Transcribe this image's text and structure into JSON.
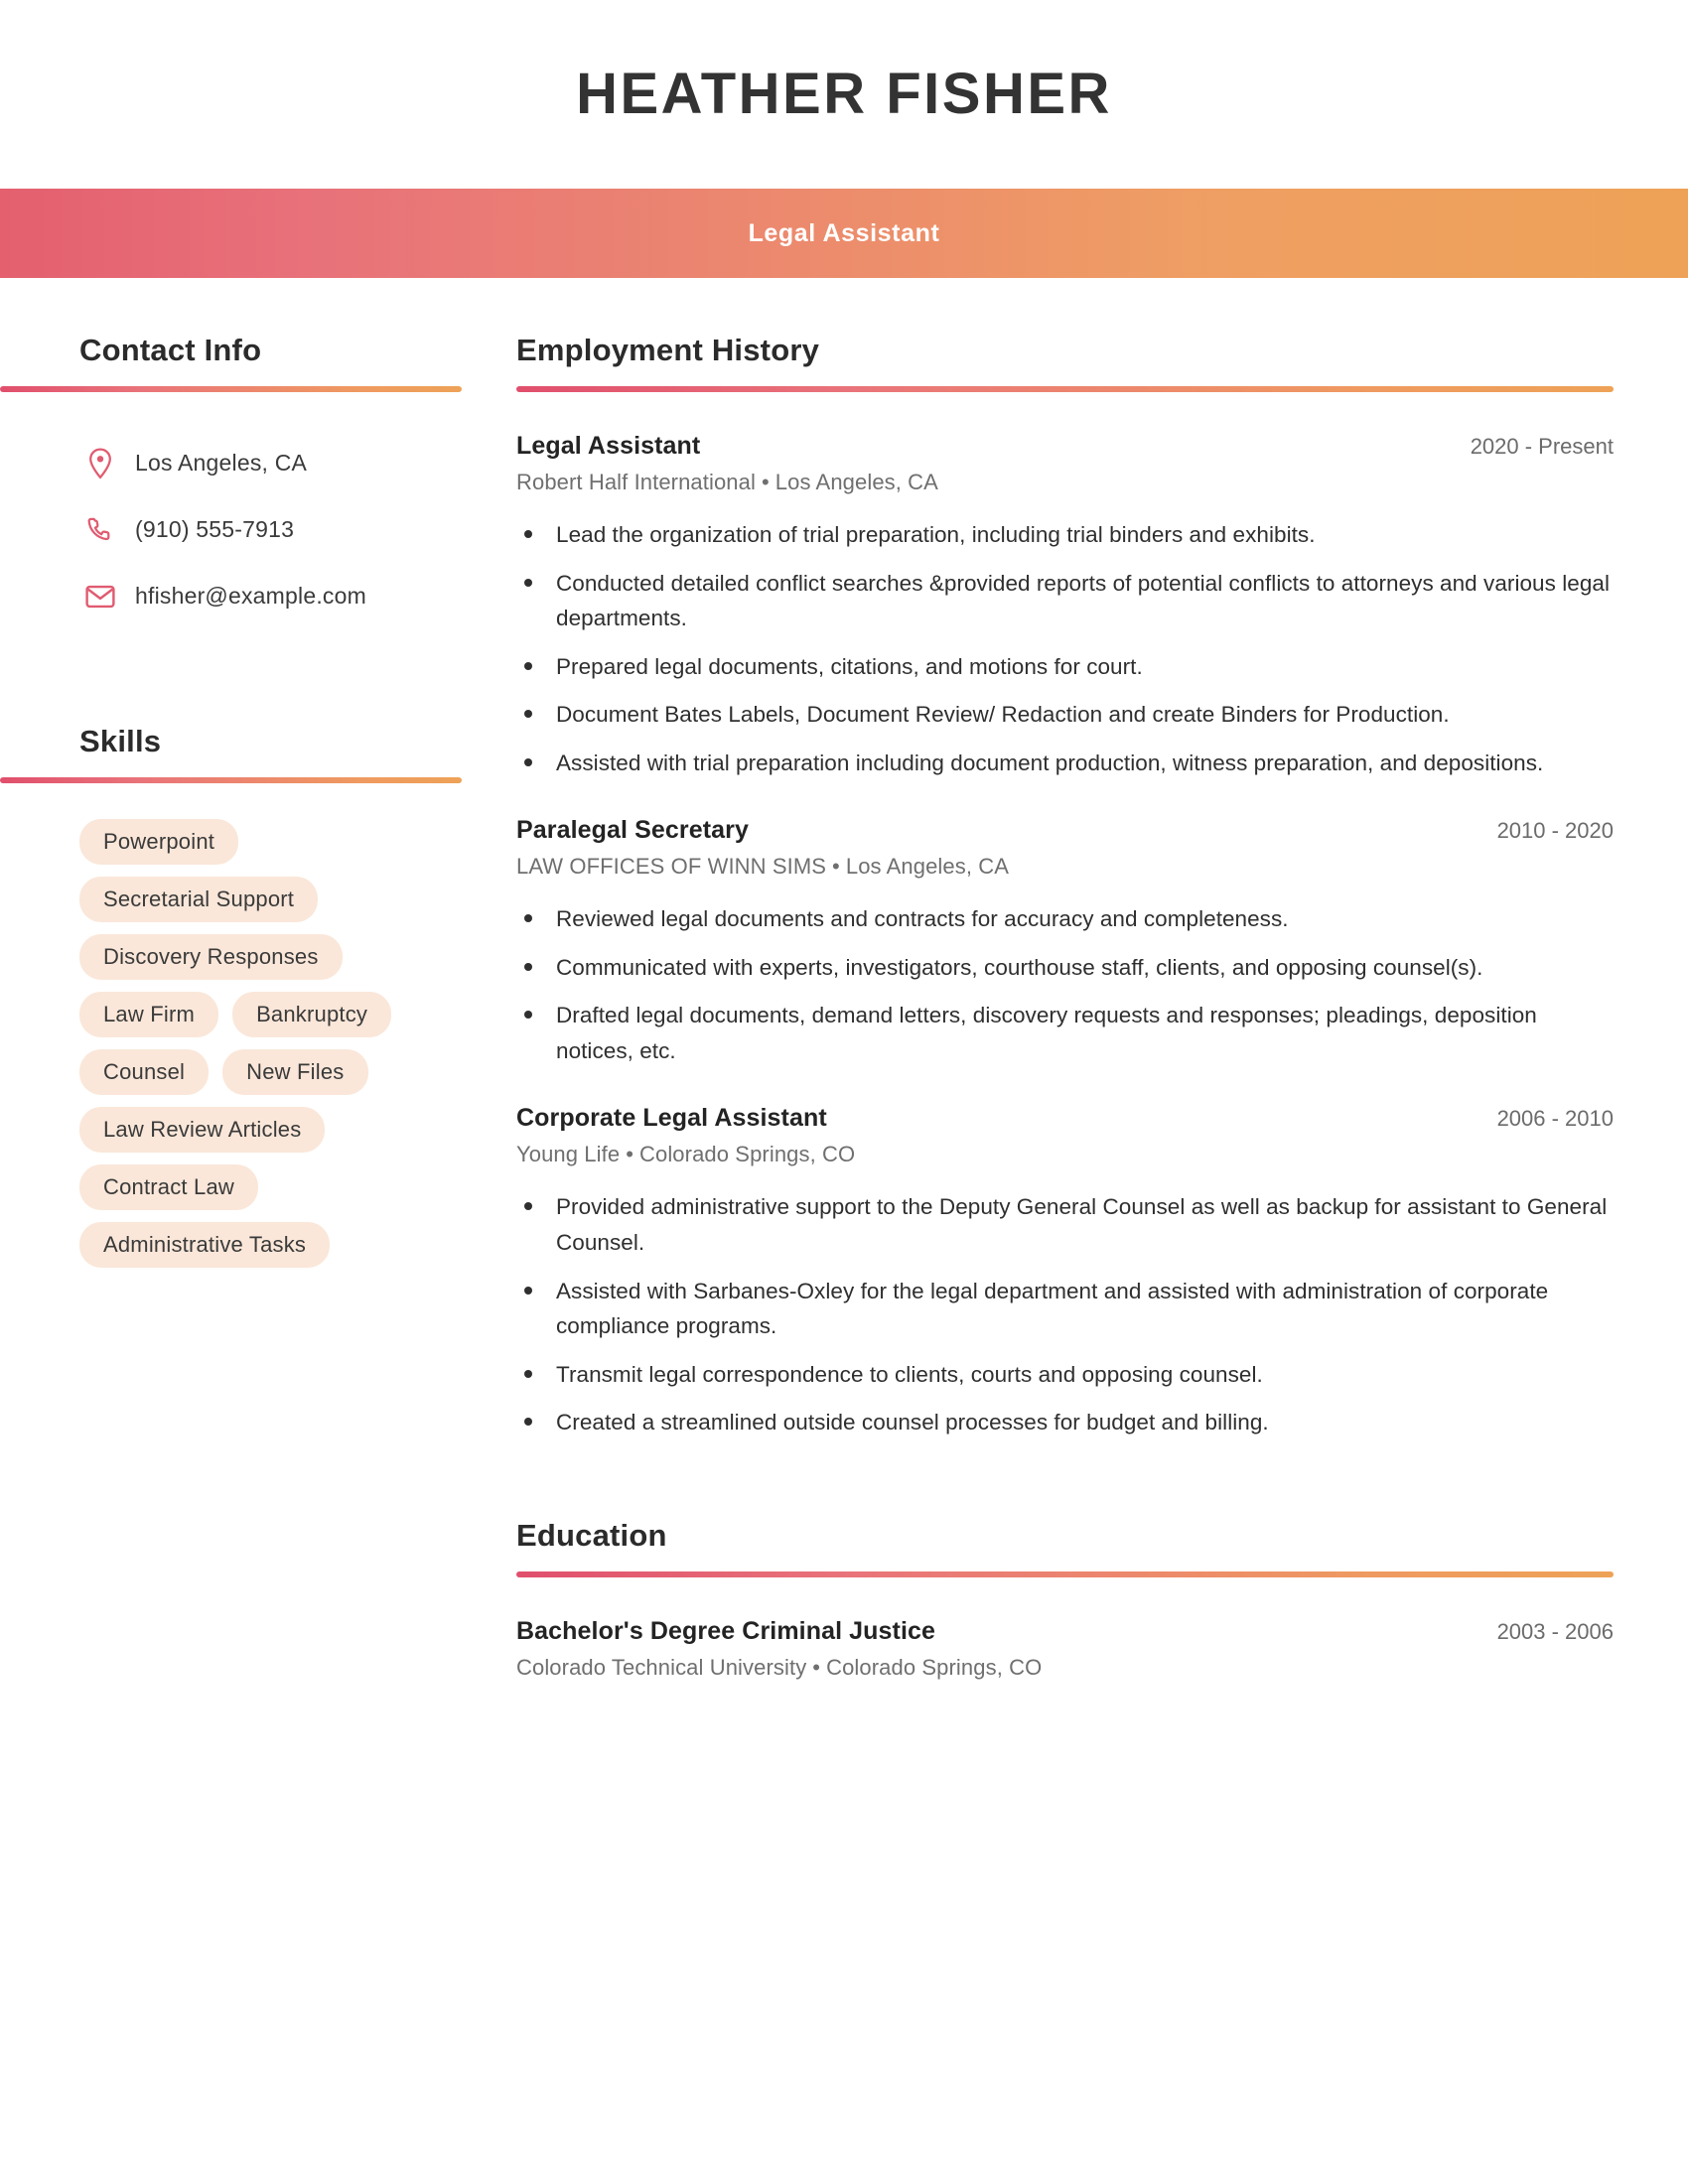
{
  "header": {
    "name": "HEATHER FISHER",
    "title": "Legal Assistant"
  },
  "colors": {
    "gradient_start": "#e4606f",
    "gradient_end": "#eea257",
    "pill_bg": "#fae7d9",
    "icon": "#e05b70",
    "heading": "#2b2b2b"
  },
  "sidebar": {
    "contact": {
      "heading": "Contact Info",
      "items": [
        {
          "icon": "location-pin-icon",
          "text": "Los Angeles, CA"
        },
        {
          "icon": "phone-icon",
          "text": "(910) 555-7913"
        },
        {
          "icon": "envelope-icon",
          "text": "hfisher@example.com"
        }
      ]
    },
    "skills": {
      "heading": "Skills",
      "items": [
        "Powerpoint",
        "Secretarial Support",
        "Discovery Responses",
        "Law Firm",
        "Bankruptcy",
        "Counsel",
        "New Files",
        "Law Review Articles",
        "Contract Law",
        "Administrative Tasks"
      ]
    }
  },
  "main": {
    "employment": {
      "heading": "Employment History",
      "entries": [
        {
          "role": "Legal Assistant",
          "dates": "2020 - Present",
          "company": "Robert Half International",
          "location": "Los Angeles, CA",
          "bullets": [
            "Lead the organization of trial preparation, including trial binders and exhibits.",
            "Conducted detailed conflict searches &provided reports of potential conflicts to attorneys and various legal departments.",
            "Prepared legal documents, citations, and motions for court.",
            "Document Bates Labels, Document Review/ Redaction and create Binders for Production.",
            "Assisted with trial preparation including document production, witness preparation, and depositions."
          ]
        },
        {
          "role": "Paralegal Secretary",
          "dates": "2010 - 2020",
          "company": "LAW OFFICES OF WINN SIMS",
          "location": "Los Angeles, CA",
          "bullets": [
            "Reviewed legal documents and contracts for accuracy and completeness.",
            "Communicated with experts, investigators, courthouse staff, clients, and opposing counsel(s).",
            "Drafted legal documents, demand letters, discovery requests and responses; pleadings, deposition notices, etc."
          ]
        },
        {
          "role": "Corporate Legal Assistant",
          "dates": "2006 - 2010",
          "company": "Young Life",
          "location": "Colorado Springs, CO",
          "bullets": [
            "Provided administrative support to the Deputy General Counsel as well as backup for assistant to General Counsel.",
            "Assisted with Sarbanes-Oxley for the legal department and assisted with administration of corporate compliance programs.",
            "Transmit legal correspondence to clients, courts and opposing counsel.",
            "Created a streamlined outside counsel processes for budget and billing."
          ]
        }
      ]
    },
    "education": {
      "heading": "Education",
      "entries": [
        {
          "degree": "Bachelor's Degree Criminal Justice",
          "dates": "2003 - 2006",
          "school": "Colorado Technical University",
          "location": "Colorado Springs, CO"
        }
      ]
    }
  }
}
